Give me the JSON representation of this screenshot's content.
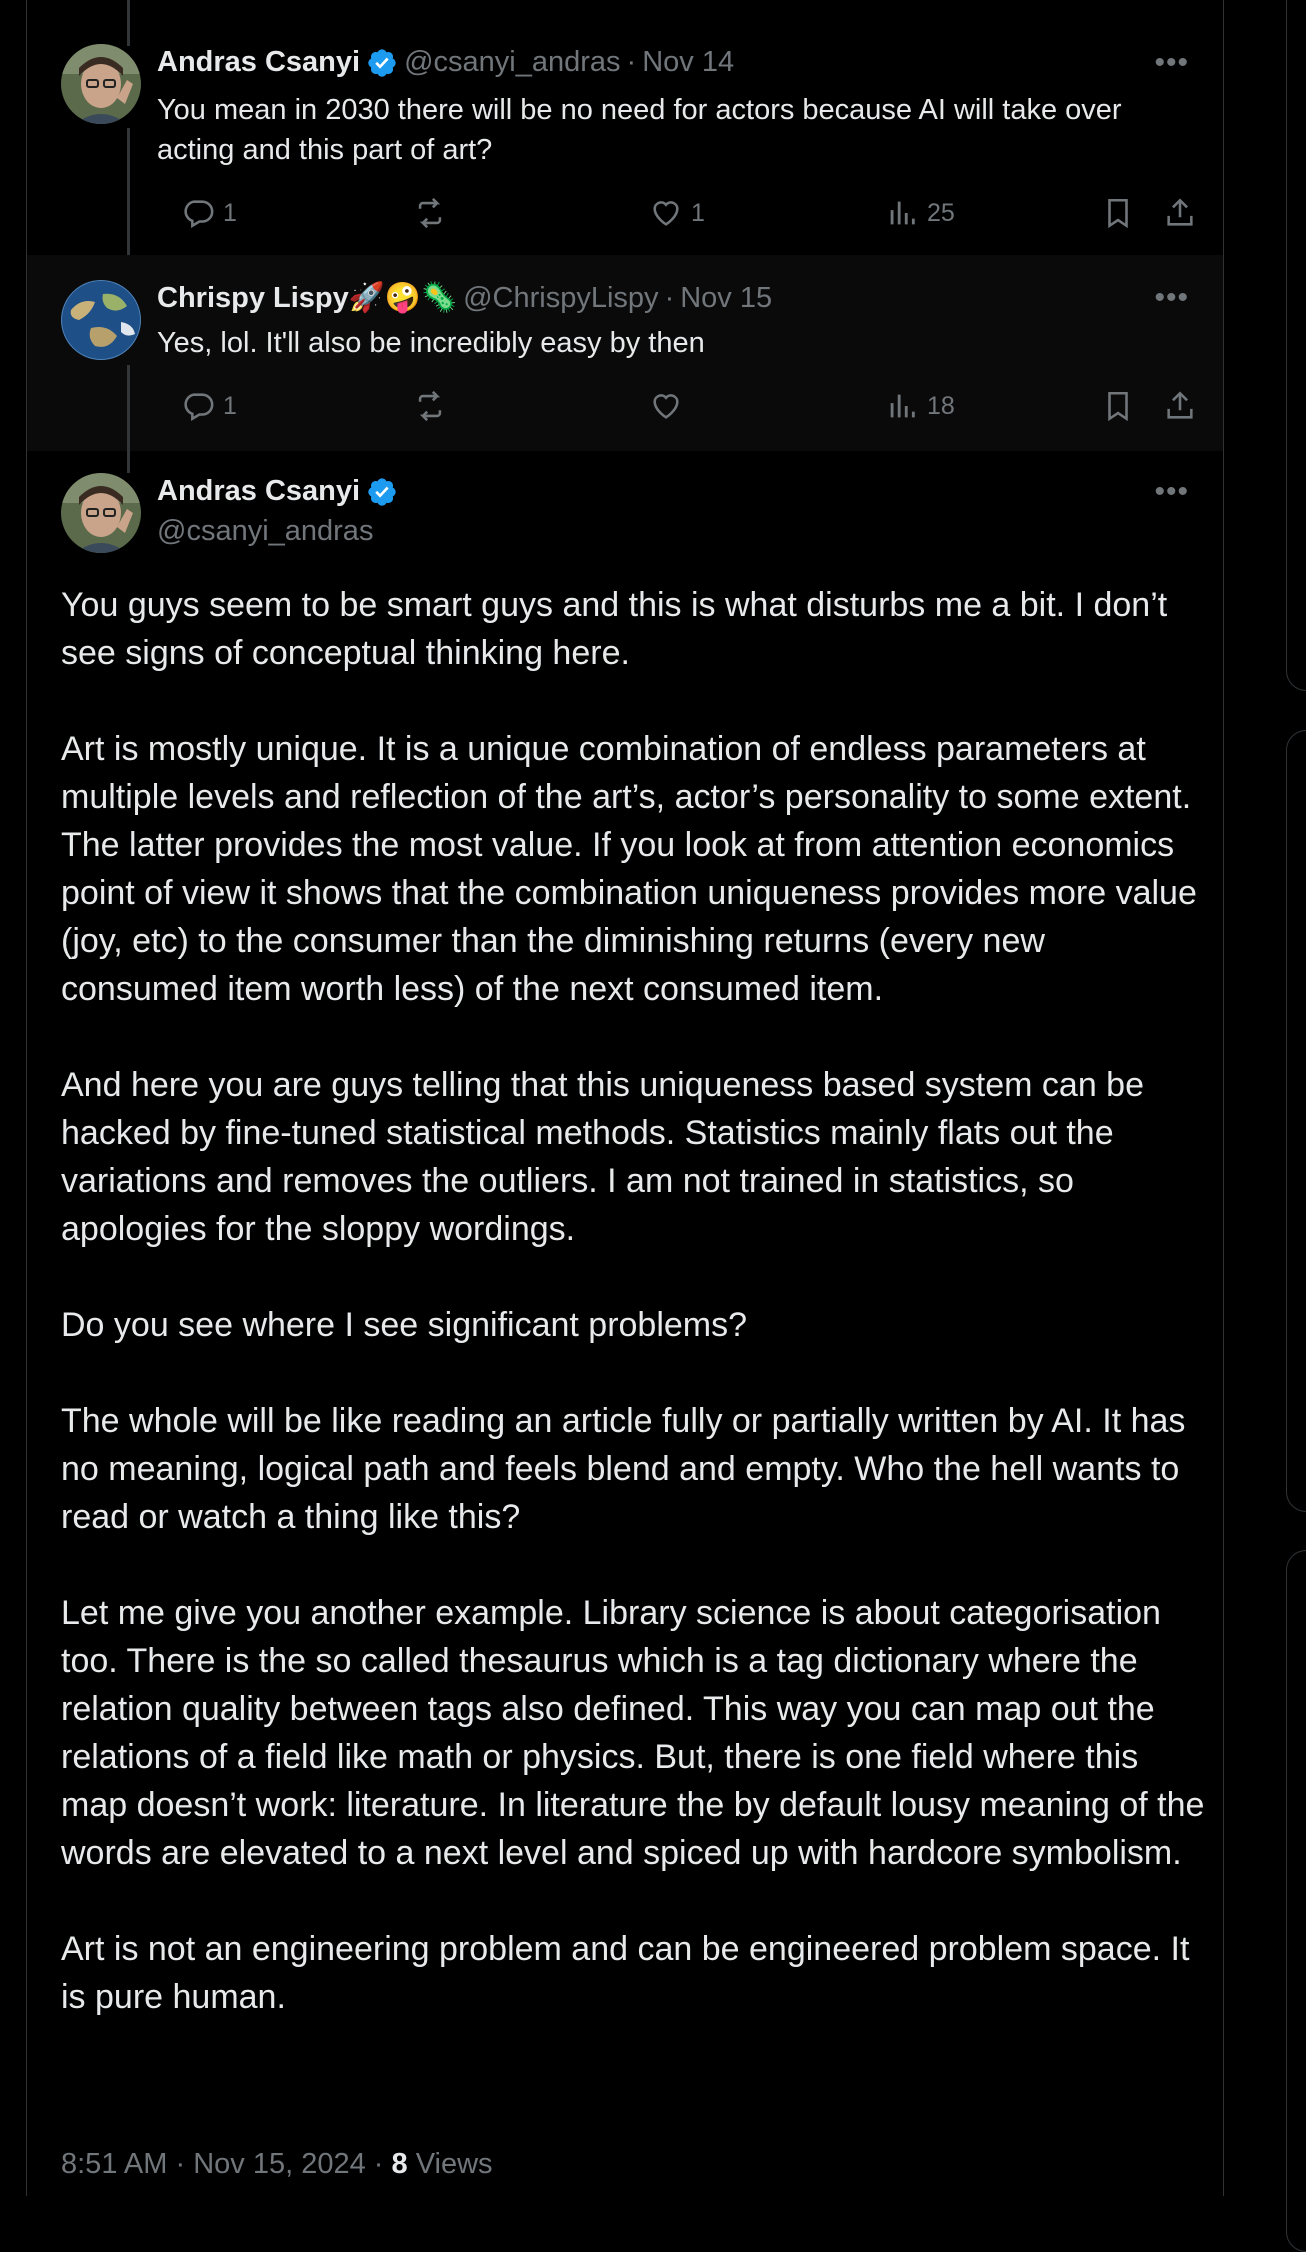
{
  "reply1": {
    "name": "Andras Csanyi",
    "handle": "@csanyi_andras",
    "sep": "·",
    "date": "Nov 14",
    "text": "You mean in 2030 there will be no need for actors because AI will take over acting and this part of art?",
    "replies": "1",
    "reposts": "",
    "likes": "1",
    "views": "25"
  },
  "reply2": {
    "name": "Chrispy Lispy🚀🤪🦠",
    "handle": "@ChrispyLispy",
    "sep": "·",
    "date": "Nov 15",
    "text": "Yes, lol. It'll also be incredibly easy by then",
    "replies": "1",
    "reposts": "",
    "likes": "",
    "views": "18"
  },
  "main": {
    "name": "Andras Csanyi",
    "handle": "@csanyi_andras",
    "paragraphs": [
      "You guys seem to be smart guys and this is what disturbs me a bit. I don’t see signs of conceptual thinking here.",
      "Art is mostly unique. It is a unique combination of endless parameters at multiple levels and reflection of the art’s, actor’s personality to some extent. The latter provides the most value. If you look at from attention economics point of view it shows that the combination uniqueness provides more value (joy, etc) to the consumer than the diminishing returns (every new consumed item worth less) of the next consumed item.",
      "And here you are guys telling that this uniqueness based system can be hacked by fine-tuned statistical methods. Statistics mainly flats out the variations and removes the outliers. I am not trained in statistics, so apologies for the sloppy wordings.",
      "Do you see where I see significant problems?",
      "The whole will be like reading an article fully or partially written by AI. It has no meaning, logical path and feels blend and empty. Who the hell wants to read or watch a thing like this?",
      "Let me give you another example. Library science is about categorisation too. There is the so called thesaurus which is a tag dictionary where the relation quality between tags also defined. This way you can map out the relations of a field like math or physics. But, there is one field where this map doesn’t work: literature. In literature the by default lousy meaning of the words are elevated to a next level and spiced up with hardcore symbolism.",
      "Art is not an engineering problem and can be engineered problem space. It is pure human."
    ],
    "time": "8:51 AM",
    "sep": "·",
    "date": "Nov 15, 2024",
    "views_count": "8",
    "views_label": "Views"
  },
  "icons": {
    "more": "more-icon",
    "reply": "reply-icon",
    "repost": "repost-icon",
    "like": "heart-icon",
    "views": "views-icon",
    "bookmark": "bookmark-icon",
    "share": "share-icon",
    "verified": "verified-badge-icon"
  },
  "colors": {
    "background": "#000000",
    "text": "#e7e9ea",
    "muted": "#71767b",
    "verified": "#1d9bf0",
    "border": "#2f3336"
  }
}
